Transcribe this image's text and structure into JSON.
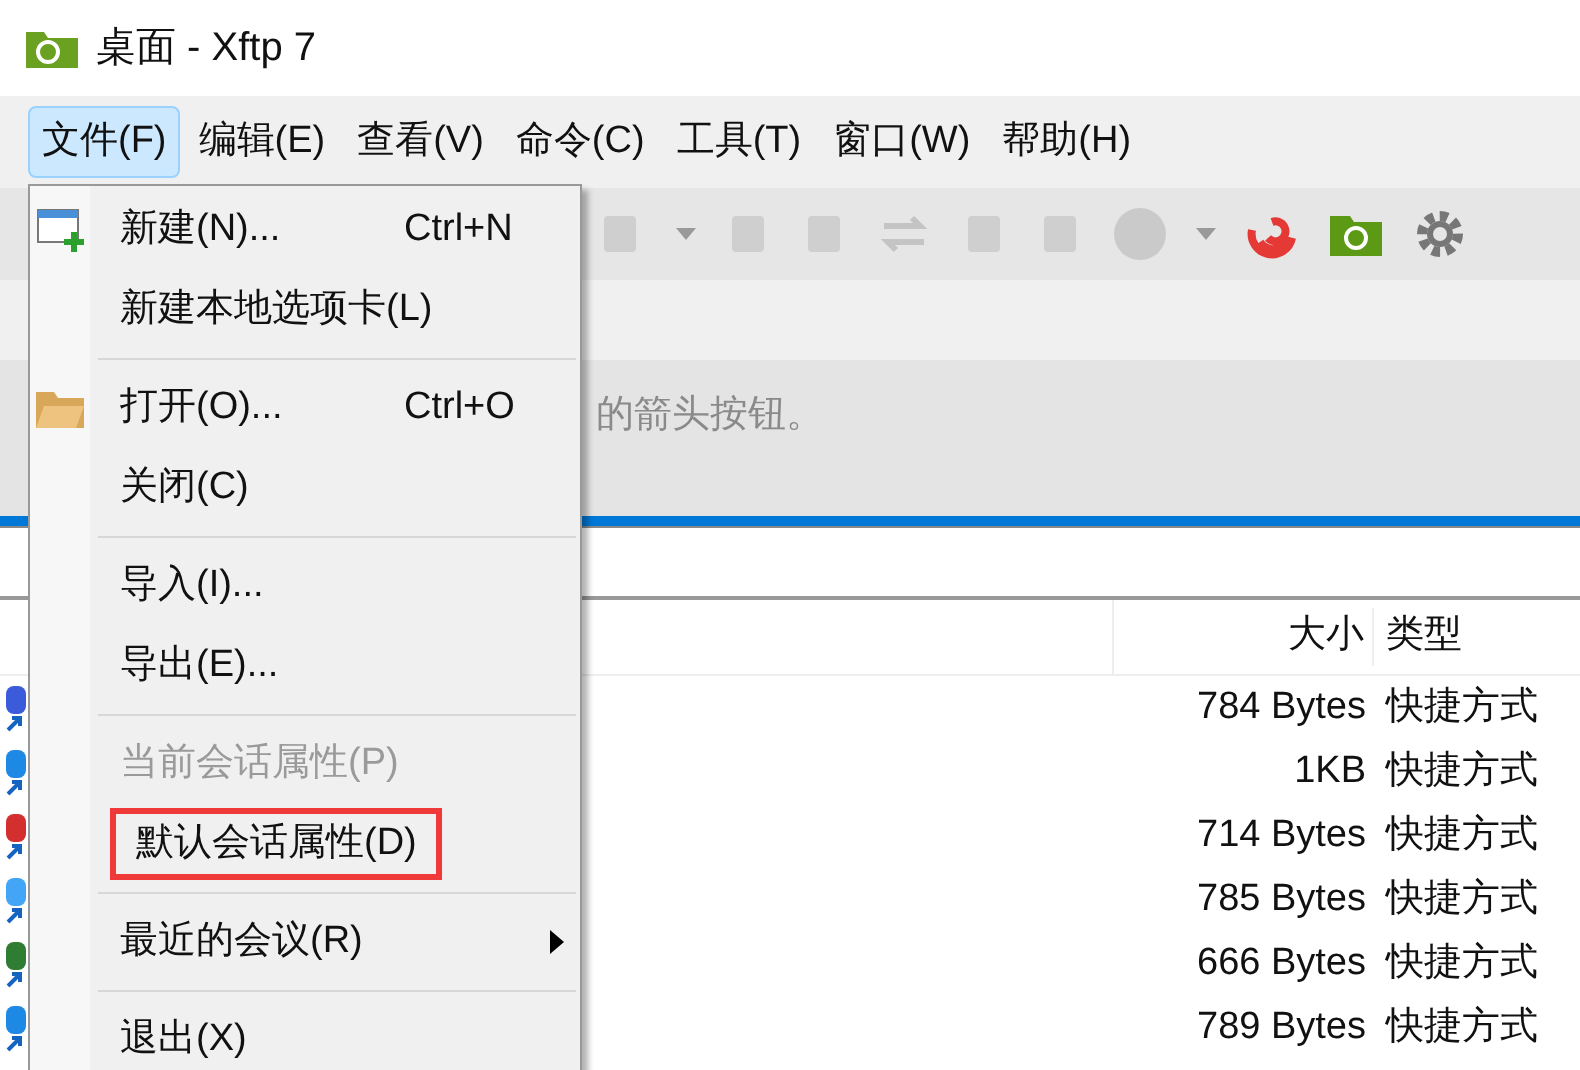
{
  "window": {
    "title": "桌面 - Xftp 7"
  },
  "menubar": [
    {
      "label": "文件(F)",
      "selected": true
    },
    {
      "label": "编辑(E)",
      "selected": false
    },
    {
      "label": "查看(V)",
      "selected": false
    },
    {
      "label": "命令(C)",
      "selected": false
    },
    {
      "label": "工具(T)",
      "selected": false
    },
    {
      "label": "窗口(W)",
      "selected": false
    },
    {
      "label": "帮助(H)",
      "selected": false
    }
  ],
  "info_bar": {
    "text": "的箭头按钮。"
  },
  "file_list": {
    "columns": [
      "大小",
      "类型"
    ],
    "rows": [
      {
        "size": "784 Bytes",
        "type": "快捷方式"
      },
      {
        "size": "1KB",
        "type": "快捷方式"
      },
      {
        "size": "714 Bytes",
        "type": "快捷方式"
      },
      {
        "size": "785 Bytes",
        "type": "快捷方式"
      },
      {
        "size": "666 Bytes",
        "type": "快捷方式"
      },
      {
        "size": "789 Bytes",
        "type": "快捷方式"
      }
    ]
  },
  "file_menu": {
    "items": [
      {
        "kind": "item",
        "label": "新建(N)...",
        "shortcut": "Ctrl+N",
        "disabled": false,
        "highlighted": false
      },
      {
        "kind": "item",
        "label": "新建本地选项卡(L)",
        "disabled": false,
        "highlighted": false
      },
      {
        "kind": "separator"
      },
      {
        "kind": "item",
        "label": "打开(O)...",
        "shortcut": "Ctrl+O",
        "disabled": false,
        "highlighted": false
      },
      {
        "kind": "item",
        "label": "关闭(C)",
        "disabled": false,
        "highlighted": false
      },
      {
        "kind": "separator"
      },
      {
        "kind": "item",
        "label": "导入(I)...",
        "disabled": false,
        "highlighted": false
      },
      {
        "kind": "item",
        "label": "导出(E)...",
        "disabled": false,
        "highlighted": false
      },
      {
        "kind": "separator"
      },
      {
        "kind": "item",
        "label": "当前会话属性(P)",
        "disabled": true,
        "highlighted": false
      },
      {
        "kind": "item",
        "label": "默认会话属性(D)",
        "disabled": false,
        "highlighted": true
      },
      {
        "kind": "separator"
      },
      {
        "kind": "submenu",
        "label": "最近的会议(R)",
        "disabled": false,
        "highlighted": false
      },
      {
        "kind": "separator"
      },
      {
        "kind": "item",
        "label": "退出(X)",
        "disabled": false,
        "highlighted": false
      }
    ]
  }
}
